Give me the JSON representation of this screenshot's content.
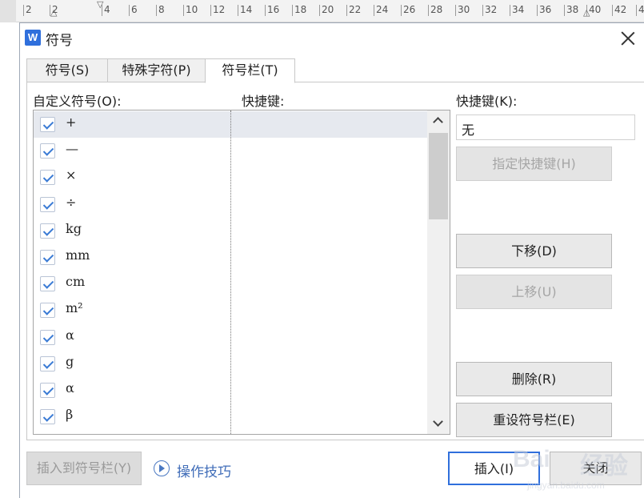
{
  "ruler": {
    "numbers": [
      "2",
      "2",
      "4",
      "6",
      "8",
      "10",
      "12",
      "14",
      "16",
      "18",
      "20",
      "22",
      "24",
      "26",
      "28",
      "30",
      "32",
      "34",
      "36",
      "38",
      "40",
      "42",
      "44"
    ]
  },
  "dialog": {
    "title": "符号",
    "app_icon": "W",
    "close_icon": "close-icon"
  },
  "tabs": [
    {
      "label": "符号(S)",
      "active": false
    },
    {
      "label": "特殊字符(P)",
      "active": false
    },
    {
      "label": "符号栏(T)",
      "active": true
    }
  ],
  "labels": {
    "custom_symbols": "自定义符号(O):",
    "shortcut_col": "快捷键:",
    "shortcut_key": "快捷键(K):"
  },
  "symbols": [
    {
      "symbol": "+",
      "checked": true,
      "shortcut": ""
    },
    {
      "symbol": "—",
      "checked": true,
      "shortcut": ""
    },
    {
      "symbol": "×",
      "checked": true,
      "shortcut": ""
    },
    {
      "symbol": "÷",
      "checked": true,
      "shortcut": ""
    },
    {
      "symbol": "kg",
      "checked": true,
      "shortcut": ""
    },
    {
      "symbol": "mm",
      "checked": true,
      "shortcut": ""
    },
    {
      "symbol": "cm",
      "checked": true,
      "shortcut": ""
    },
    {
      "symbol": "m²",
      "checked": true,
      "shortcut": ""
    },
    {
      "symbol": "α",
      "checked": true,
      "shortcut": ""
    },
    {
      "symbol": "g",
      "checked": true,
      "shortcut": ""
    },
    {
      "symbol": "α",
      "checked": true,
      "shortcut": ""
    },
    {
      "symbol": "β",
      "checked": true,
      "shortcut": ""
    }
  ],
  "selected_row": 0,
  "shortcut_input": {
    "value": "无"
  },
  "buttons": {
    "assign_shortcut": "指定快捷键(H)",
    "move_down": "下移(D)",
    "move_up": "上移(U)",
    "delete": "删除(R)",
    "reset": "重设符号栏(E)"
  },
  "bottom": {
    "insert_to_bar": "插入到符号栏(Y)",
    "tips": "操作技巧",
    "insert": "插入(I)",
    "close": "关闭"
  },
  "watermark": {
    "text": "Bai",
    "text2": "经验",
    "sub": "jingyan.baidu.com"
  },
  "colors": {
    "accent": "#2f6fdc",
    "check": "#3a7bd5",
    "link": "#3f6cb8"
  }
}
